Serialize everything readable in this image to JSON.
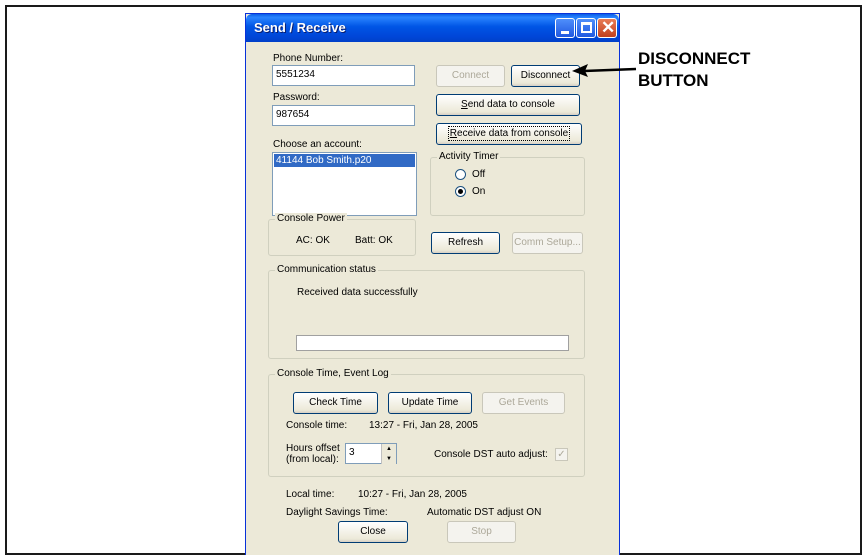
{
  "window": {
    "title": "Send / Receive"
  },
  "phone": {
    "label": "Phone Number:",
    "value": "5551234"
  },
  "password": {
    "label": "Password:",
    "value": "987654"
  },
  "account": {
    "label": "Choose an account:",
    "items": [
      "41144 Bob Smith.p20"
    ]
  },
  "buttons": {
    "connect": "Connect",
    "disconnect": "Disconnect",
    "send": "Send data to console",
    "receive": "Receive data from console",
    "refresh": "Refresh",
    "comm_setup": "Comm Setup...",
    "check_time": "Check Time",
    "update_time": "Update Time",
    "get_events": "Get Events",
    "close": "Close",
    "stop": "Stop"
  },
  "activity_timer": {
    "label": "Activity Timer",
    "off": "Off",
    "on": "On",
    "selected": "On"
  },
  "console_power": {
    "label": "Console Power",
    "ac": "AC: OK",
    "batt": "Batt: OK"
  },
  "comm_status": {
    "label": "Communication status",
    "message": "Received data successfully",
    "progress": 0
  },
  "console_time": {
    "label": "Console Time, Event Log",
    "time_label": "Console time:",
    "time_value": "13:27  -  Fri, Jan 28, 2005",
    "offset_label_1": "Hours offset",
    "offset_label_2": "(from local):",
    "offset_value": "3",
    "dst_label": "Console DST auto adjust:",
    "dst_checked": true
  },
  "local": {
    "time_label": "Local time:",
    "time_value": "10:27  -  Fri, Jan 28, 2005",
    "dst_label": "Daylight Savings Time:",
    "dst_value": "Automatic DST adjust ON"
  },
  "annotation": {
    "line1": "DISCONNECT",
    "line2": "BUTTON"
  }
}
